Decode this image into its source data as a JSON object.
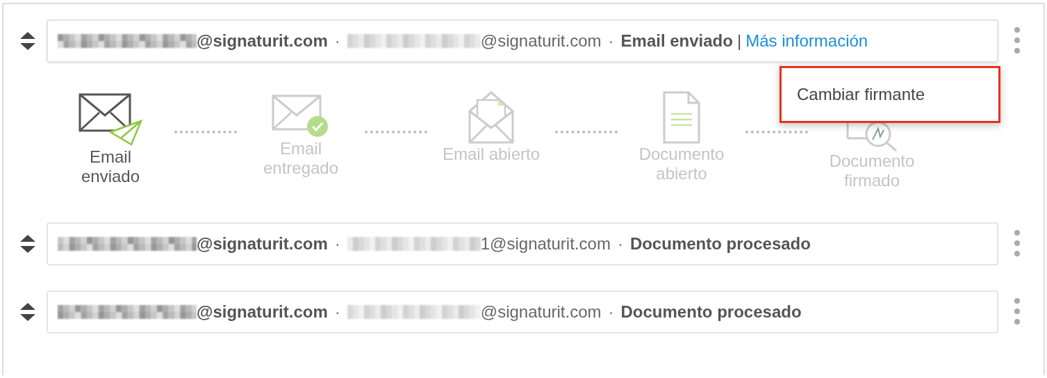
{
  "signers": [
    {
      "sender": "@signaturit.com",
      "recipient": "@signaturit.com",
      "status": "Email enviado",
      "link": "Más información",
      "expanded": true,
      "steps": [
        {
          "kind": "sent",
          "label": "Email enviado",
          "done": true
        },
        {
          "kind": "delivered",
          "label": "Email entregado",
          "done": false
        },
        {
          "kind": "opened",
          "label": "Email abierto",
          "done": false
        },
        {
          "kind": "document",
          "label": "Documento abierto",
          "done": false
        },
        {
          "kind": "signed",
          "label": "Documento firmado",
          "done": false
        }
      ]
    },
    {
      "sender": "@signaturit.com",
      "recipient": "1@signaturit.com",
      "status": "Documento procesado",
      "expanded": false
    },
    {
      "sender": "@signaturit.com",
      "recipient": "@signaturit.com",
      "status": "Documento procesado",
      "expanded": false
    }
  ],
  "separator": "·",
  "divider": "|",
  "menu": {
    "items": [
      "Cambiar firmante"
    ],
    "highlighted": true
  }
}
